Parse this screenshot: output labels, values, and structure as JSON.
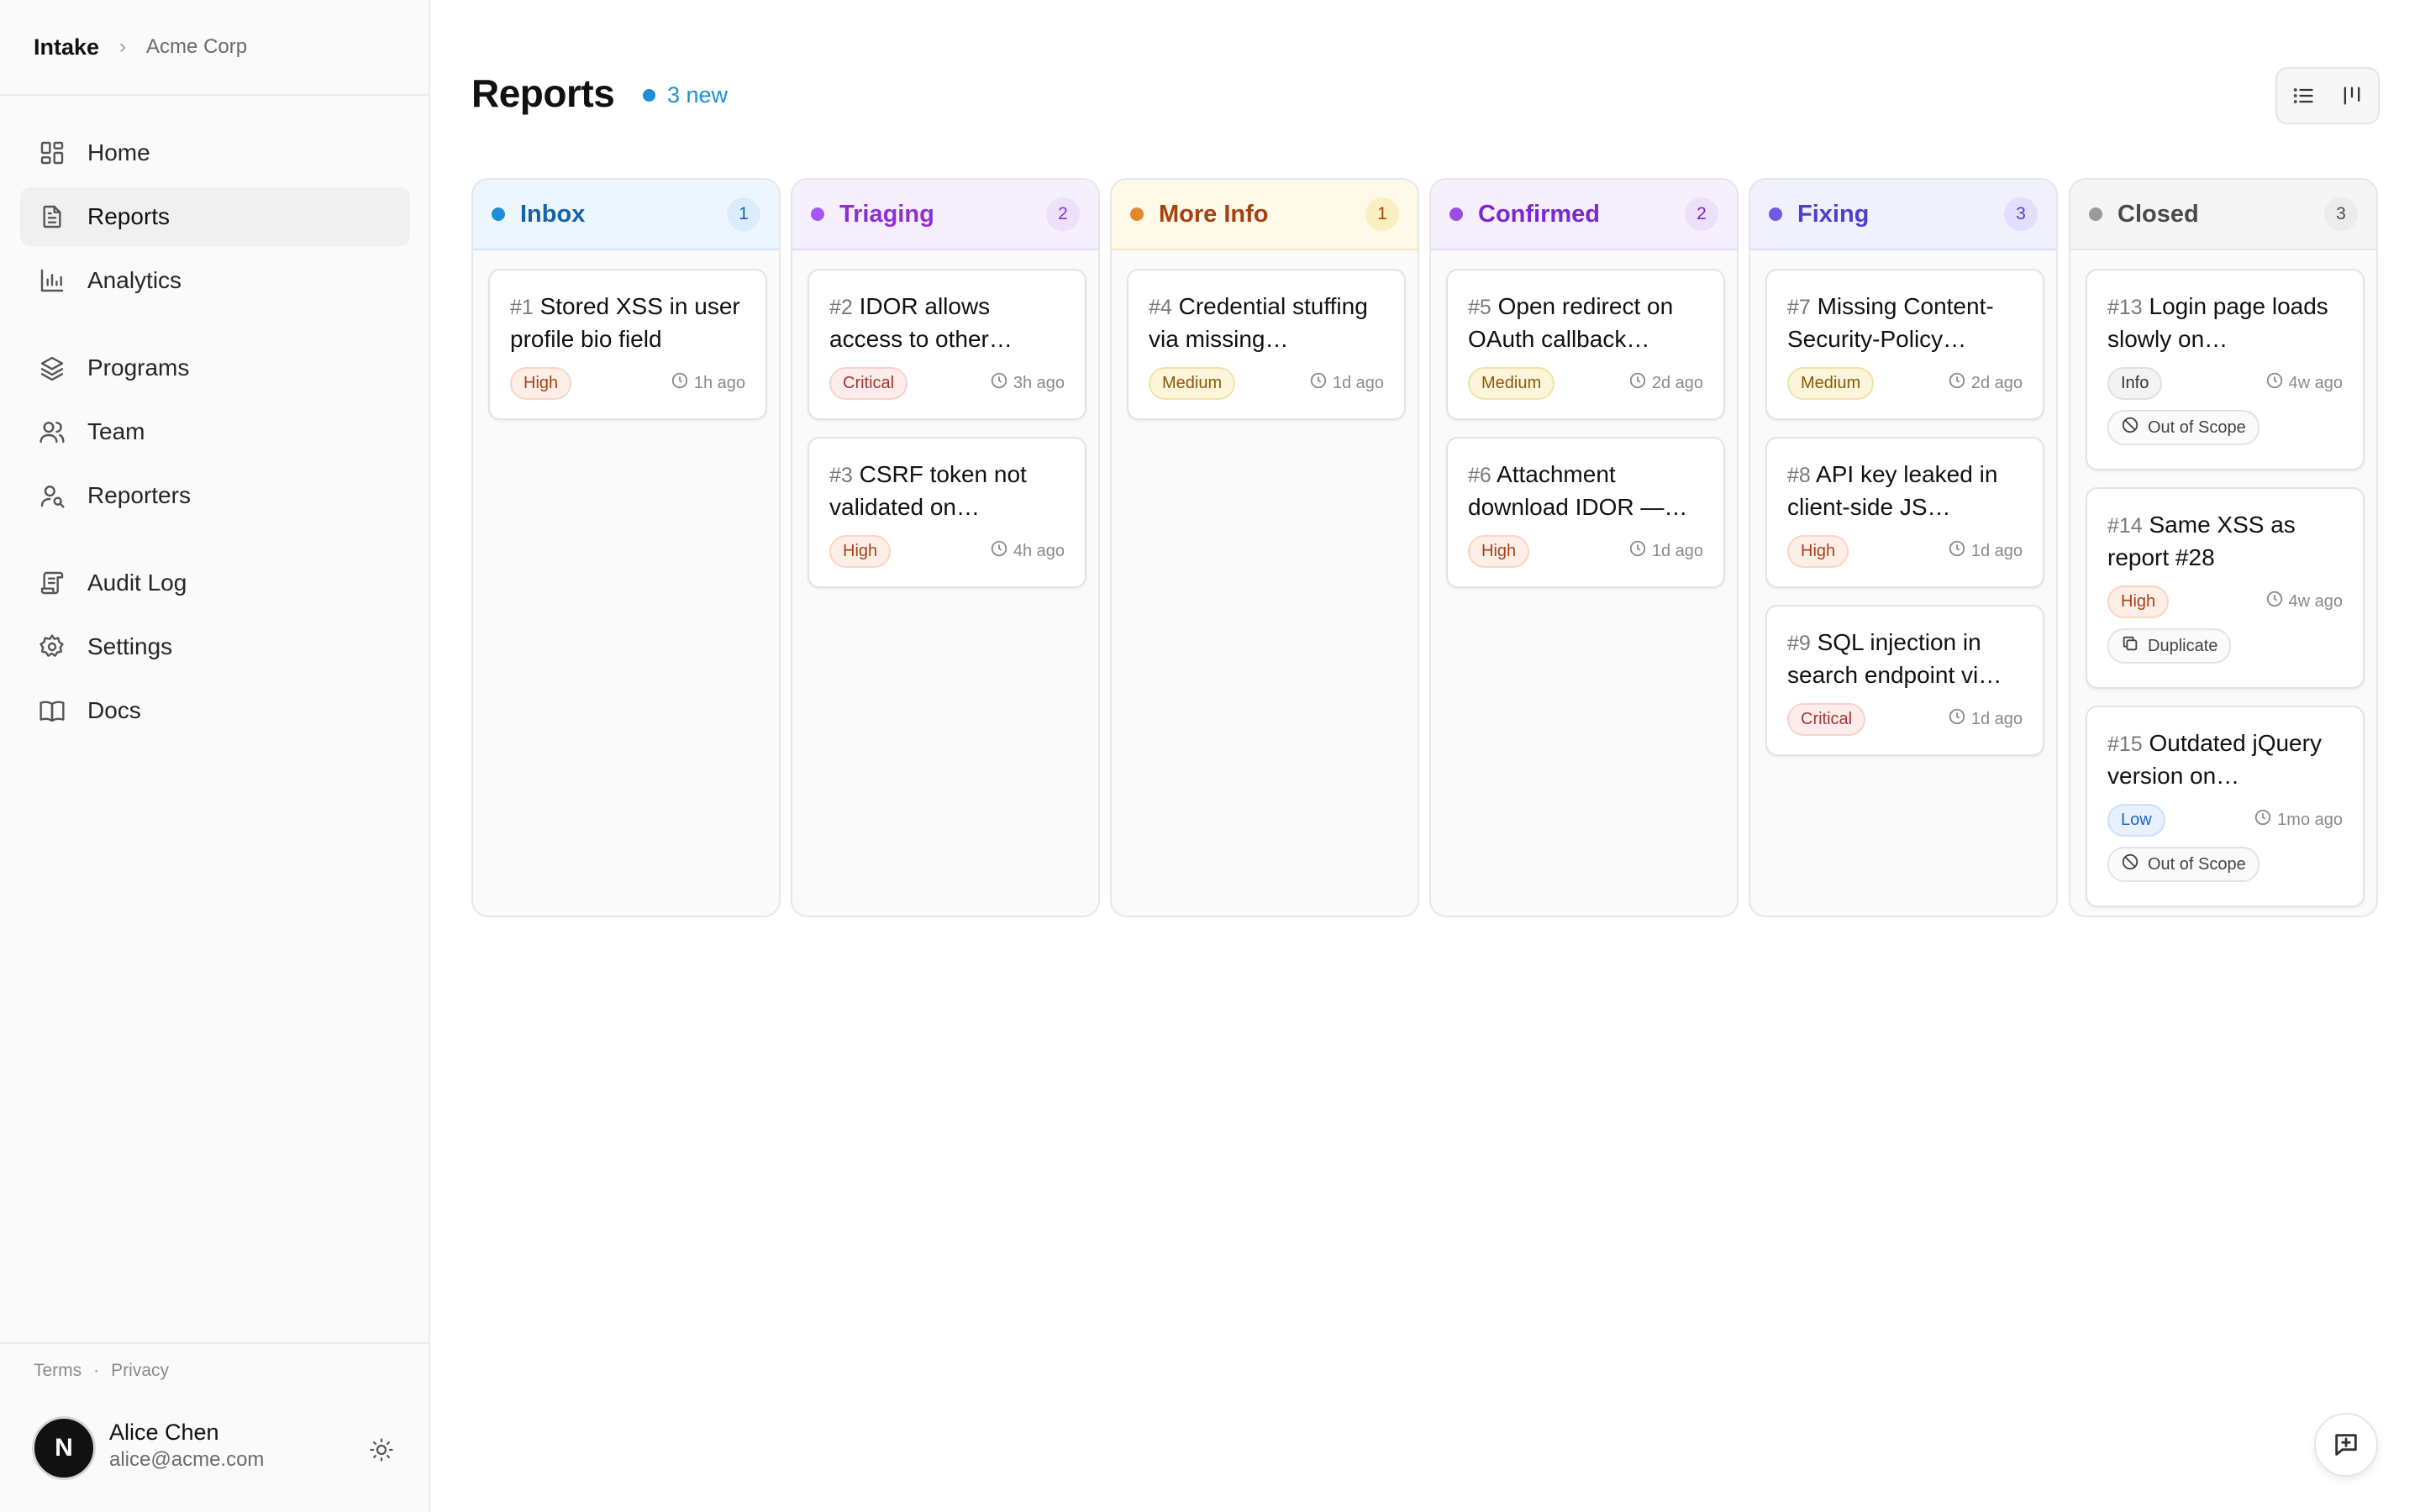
{
  "breadcrumb": {
    "app": "Intake",
    "separator": "›",
    "org": "Acme Corp"
  },
  "nav": [
    {
      "label": "Home",
      "icon": "home-icon",
      "active": false
    },
    {
      "label": "Reports",
      "icon": "document-icon",
      "active": true
    },
    {
      "label": "Analytics",
      "icon": "bar-chart-icon",
      "active": false
    },
    {
      "label": "Programs",
      "icon": "layers-icon",
      "active": false
    },
    {
      "label": "Team",
      "icon": "users-icon",
      "active": false
    },
    {
      "label": "Reporters",
      "icon": "user-search-icon",
      "active": false
    },
    {
      "label": "Audit Log",
      "icon": "scroll-icon",
      "active": false
    },
    {
      "label": "Settings",
      "icon": "gear-icon",
      "active": false
    },
    {
      "label": "Docs",
      "icon": "book-icon",
      "active": false
    }
  ],
  "footer": {
    "terms": "Terms",
    "dot": "·",
    "privacy": "Privacy",
    "avatar_initial": "N",
    "user_name": "Alice Chen",
    "user_email": "alice@acme.com"
  },
  "page": {
    "title": "Reports",
    "new_count": "3 new",
    "accent": "#1e8fd6"
  },
  "columns": [
    {
      "title": "Inbox",
      "count": "1",
      "color": "#1e8fd6",
      "text": "#1763a8",
      "bg": "#eef6fd",
      "line": "#cfe4f6",
      "badge_bg": "#dcecfb",
      "cards": [
        {
          "num": "#1",
          "title": "Stored XSS in user profile bio field",
          "severity": "High",
          "time": "1h ago"
        }
      ]
    },
    {
      "title": "Triaging",
      "count": "2",
      "color": "#a855f7",
      "text": "#8e2fd6",
      "bg": "#f6f0fd",
      "line": "#e6d6f8",
      "badge_bg": "#ece0fb",
      "cards": [
        {
          "num": "#2",
          "title": "IDOR allows access to other…",
          "severity": "Critical",
          "time": "3h ago"
        },
        {
          "num": "#3",
          "title": "CSRF token not validated on…",
          "severity": "High",
          "time": "4h ago"
        }
      ]
    },
    {
      "title": "More Info",
      "count": "1",
      "color": "#e08a2c",
      "text": "#a5420f",
      "bg": "#fefae9",
      "line": "#f3e6b8",
      "badge_bg": "#fbefc0",
      "cards": [
        {
          "num": "#4",
          "title": "Credential stuffing via missing…",
          "severity": "Medium",
          "time": "1d ago"
        }
      ]
    },
    {
      "title": "Confirmed",
      "count": "2",
      "color": "#9b4ee6",
      "text": "#7c27cf",
      "bg": "#f6f0fd",
      "line": "#e6d6f8",
      "badge_bg": "#ece0fb",
      "cards": [
        {
          "num": "#5",
          "title": "Open redirect on OAuth callback…",
          "severity": "Medium",
          "time": "2d ago"
        },
        {
          "num": "#6",
          "title": "Attachment download IDOR —…",
          "severity": "High",
          "time": "1d ago"
        }
      ]
    },
    {
      "title": "Fixing",
      "count": "3",
      "color": "#6f5ae8",
      "text": "#4f3fcf",
      "bg": "#f1f0fd",
      "line": "#dcd8f8",
      "badge_bg": "#e2defb",
      "cards": [
        {
          "num": "#7",
          "title": "Missing Content-Security-Policy…",
          "severity": "Medium",
          "time": "2d ago"
        },
        {
          "num": "#8",
          "title": "API key leaked in client-side JS…",
          "severity": "High",
          "time": "1d ago"
        },
        {
          "num": "#9",
          "title": "SQL injection in search endpoint vi…",
          "severity": "Critical",
          "time": "1d ago"
        }
      ]
    },
    {
      "title": "Closed",
      "count": "3",
      "color": "#9a9a9a",
      "text": "#4a4a4a",
      "bg": "#f5f5f5",
      "line": "#e6e6e6",
      "badge_bg": "#ececec",
      "cards": [
        {
          "num": "#13",
          "title": "Login page loads slowly on…",
          "severity": "Info",
          "time": "4w ago",
          "resolution": "Out of Scope",
          "res_icon": "ban-icon"
        },
        {
          "num": "#14",
          "title": "Same XSS as report #28",
          "severity": "High",
          "time": "4w ago",
          "resolution": "Duplicate",
          "res_icon": "copy-icon"
        },
        {
          "num": "#15",
          "title": "Outdated jQuery version on…",
          "severity": "Low",
          "time": "1mo ago",
          "resolution": "Out of Scope",
          "res_icon": "ban-icon"
        }
      ]
    }
  ]
}
